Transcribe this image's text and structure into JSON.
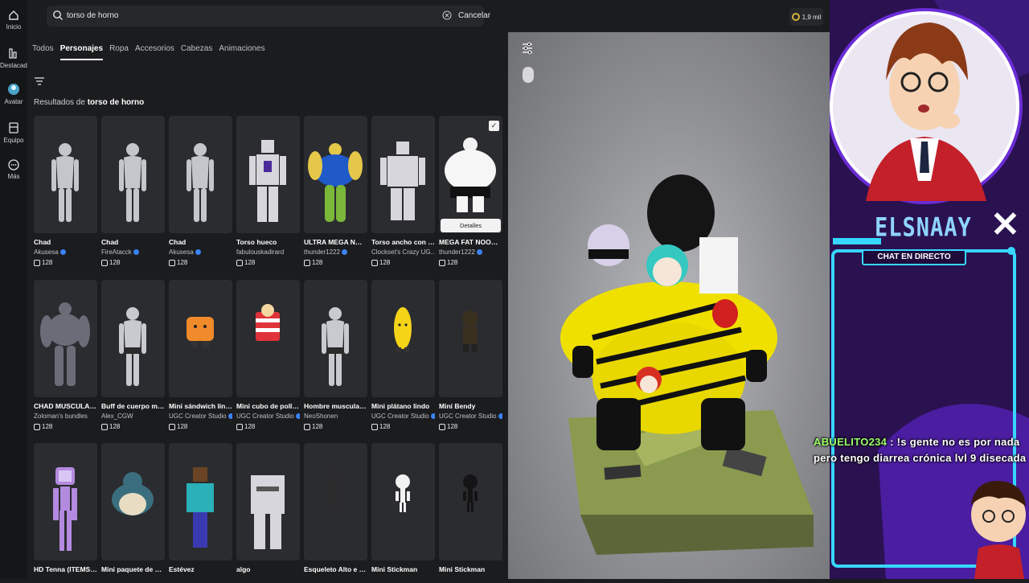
{
  "nav": [
    {
      "label": "Inicio",
      "icon": "home-icon"
    },
    {
      "label": "Destacados",
      "icon": "chart-icon"
    },
    {
      "label": "Avatar",
      "icon": "avatar-icon"
    },
    {
      "label": "Equipo",
      "icon": "inventory-icon"
    },
    {
      "label": "Más",
      "icon": "more-icon"
    }
  ],
  "search": {
    "query": "torso de horno",
    "cancel_label": "Cancelar"
  },
  "balance": "1,9 mil",
  "tabs": [
    "Todos",
    "Personajes",
    "Ropa",
    "Accesorios",
    "Cabezas",
    "Animaciones"
  ],
  "active_tab": "Personajes",
  "results": {
    "prefix": "Resultados de",
    "query": "torso de horno"
  },
  "details_label": "Detalles",
  "items": [
    {
      "name": "Chad",
      "creator": "Akusesa",
      "verified": true,
      "price": "128",
      "figure": "chad"
    },
    {
      "name": "Chad",
      "creator": "FireAtacck",
      "verified": true,
      "price": "128",
      "figure": "chad"
    },
    {
      "name": "Chad",
      "creator": "Akusesa",
      "verified": true,
      "price": "128",
      "figure": "chad"
    },
    {
      "name": "Torso hueco",
      "creator": "fabulouskadirard",
      "verified": false,
      "price": "128",
      "figure": "hollow"
    },
    {
      "name": "ULTRA MEGA NOOB",
      "creator": "thunder1222",
      "verified": true,
      "price": "128",
      "figure": "noob"
    },
    {
      "name": "Torso ancho con fo...",
      "creator": "Clockset's Crazy UG...",
      "verified": false,
      "price": "128",
      "figure": "wide"
    },
    {
      "name": "MEGA FAT NOOB [...",
      "creator": "thunder1222",
      "verified": true,
      "price": "128",
      "figure": "fat"
    },
    {
      "name": "CHAD MUSCULAR ...",
      "creator": "Zoloman's bundles",
      "verified": false,
      "price": "128",
      "figure": "muscle"
    },
    {
      "name": "Buff de cuerpo mus...",
      "creator": "Alex_CGW",
      "verified": false,
      "price": "128",
      "figure": "buff"
    },
    {
      "name": "Mini sándwich lindo",
      "creator": "UGC Creator Studio",
      "verified": true,
      "price": "128",
      "figure": "sandwich"
    },
    {
      "name": "Mini cubo de pollo l...",
      "creator": "UGC Creator Studio",
      "verified": true,
      "price": "128",
      "figure": "bucket"
    },
    {
      "name": "Hombre muscular d...",
      "creator": "NeoShonen",
      "verified": false,
      "price": "128",
      "figure": "buff"
    },
    {
      "name": "Mini plátano lindo",
      "creator": "UGC Creator Studio",
      "verified": true,
      "price": "128",
      "figure": "banana"
    },
    {
      "name": "Mini Bendy",
      "creator": "UGC Creator Studio",
      "verified": true,
      "price": "128",
      "figure": "bendy"
    },
    {
      "name": "HD Tenna (ITEMS E...",
      "creator": "",
      "verified": false,
      "price": "",
      "figure": "tenna"
    },
    {
      "name": "Mini paquete de Sn...",
      "creator": "",
      "verified": false,
      "price": "",
      "figure": "snorlax"
    },
    {
      "name": "Estévez",
      "creator": "",
      "verified": false,
      "price": "",
      "figure": "steve"
    },
    {
      "name": "algo",
      "creator": "",
      "verified": false,
      "price": "",
      "figure": "block"
    },
    {
      "name": "Esqueleto Alto e Fino",
      "creator": "",
      "verified": false,
      "price": "",
      "figure": "slender"
    },
    {
      "name": "Mini Stickman",
      "creator": "",
      "verified": false,
      "price": "",
      "figure": "stick-white"
    },
    {
      "name": "Mini Stickman",
      "creator": "",
      "verified": false,
      "price": "",
      "figure": "stick-black"
    }
  ],
  "selected_item": 6,
  "overlay": {
    "streamer": "ELSNAAY",
    "chat_label": "CHAT EN DIRECTO",
    "chat_user": "ABUELITO234",
    "chat_text": ": !s gente no es por nada pero tengo diarrea crónica lvl 9 disecada"
  },
  "colors": {
    "accent": "#37d7ff",
    "overlay_bg": "#2a1150",
    "chat_user": "#9cff6a",
    "verified": "#3b82f6"
  }
}
